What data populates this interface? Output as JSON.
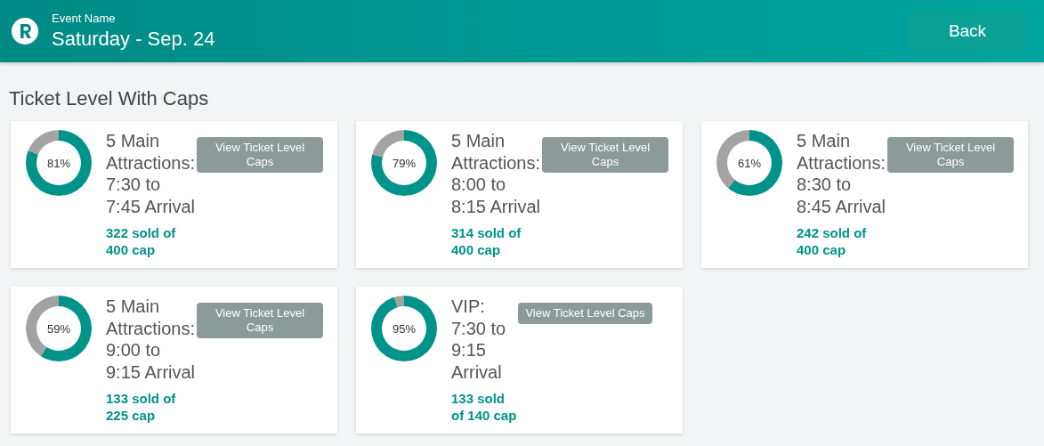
{
  "header": {
    "label": "Event Name",
    "title": "Saturday - Sep. 24",
    "back_button": "Back"
  },
  "section_title": "Ticket Level With Caps",
  "cards": [
    {
      "percent": "81%",
      "title": "5 Main\nAttractions:\n7:30 to\n7:45 Arrival",
      "button": "View Ticket Level Caps",
      "sold": "322 sold of\n400 cap"
    },
    {
      "percent": "79%",
      "title": "5 Main\nAttractions:\n8:00 to\n8:15 Arrival",
      "button": "View Ticket Level Caps",
      "sold": "314 sold of\n400 cap"
    },
    {
      "percent": "61%",
      "title": "5 Main\nAttractions:\n8:30 to\n8:45 Arrival",
      "button": "View Ticket Level Caps",
      "sold": "242 sold of\n400 cap"
    },
    {
      "percent": "59%",
      "title": "5 Main\nAttractions:\n9:00 to\n9:15 Arrival",
      "button": "View Ticket Level Caps",
      "sold": "133 sold of\n225 cap"
    },
    {
      "percent": "95%",
      "title": "VIP:\n7:30 to\n9:15\nArrival",
      "button": "View Ticket Level Caps",
      "sold": "133 sold\nof 140 cap"
    }
  ]
}
